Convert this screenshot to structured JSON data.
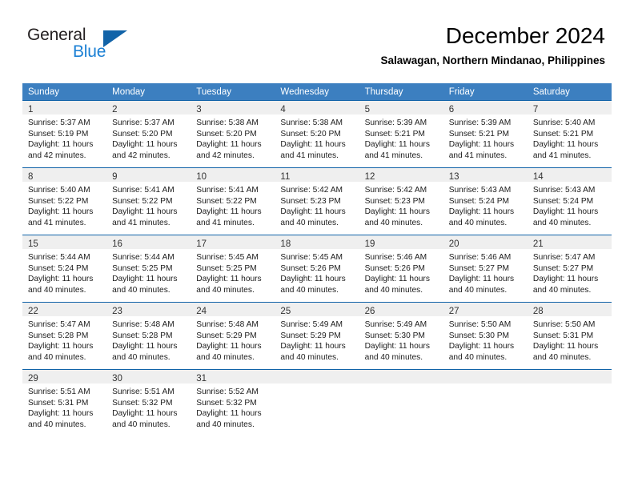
{
  "brand": {
    "name_part1": "General",
    "name_part2": "Blue",
    "accent_color": "#1163a8",
    "logo_blue_text_color": "#1a7fd4"
  },
  "header": {
    "title": "December 2024",
    "subtitle": "Salawagan, Northern Mindanao, Philippines"
  },
  "calendar": {
    "header_bg": "#3c7fc0",
    "row_line_color": "#1163a8",
    "daynum_band_bg": "#efefef",
    "weekday_headers": [
      "Sunday",
      "Monday",
      "Tuesday",
      "Wednesday",
      "Thursday",
      "Friday",
      "Saturday"
    ],
    "weeks": [
      [
        {
          "day": "1",
          "sunrise": "Sunrise: 5:37 AM",
          "sunset": "Sunset: 5:19 PM",
          "daylight": "Daylight: 11 hours and 42 minutes."
        },
        {
          "day": "2",
          "sunrise": "Sunrise: 5:37 AM",
          "sunset": "Sunset: 5:20 PM",
          "daylight": "Daylight: 11 hours and 42 minutes."
        },
        {
          "day": "3",
          "sunrise": "Sunrise: 5:38 AM",
          "sunset": "Sunset: 5:20 PM",
          "daylight": "Daylight: 11 hours and 42 minutes."
        },
        {
          "day": "4",
          "sunrise": "Sunrise: 5:38 AM",
          "sunset": "Sunset: 5:20 PM",
          "daylight": "Daylight: 11 hours and 41 minutes."
        },
        {
          "day": "5",
          "sunrise": "Sunrise: 5:39 AM",
          "sunset": "Sunset: 5:21 PM",
          "daylight": "Daylight: 11 hours and 41 minutes."
        },
        {
          "day": "6",
          "sunrise": "Sunrise: 5:39 AM",
          "sunset": "Sunset: 5:21 PM",
          "daylight": "Daylight: 11 hours and 41 minutes."
        },
        {
          "day": "7",
          "sunrise": "Sunrise: 5:40 AM",
          "sunset": "Sunset: 5:21 PM",
          "daylight": "Daylight: 11 hours and 41 minutes."
        }
      ],
      [
        {
          "day": "8",
          "sunrise": "Sunrise: 5:40 AM",
          "sunset": "Sunset: 5:22 PM",
          "daylight": "Daylight: 11 hours and 41 minutes."
        },
        {
          "day": "9",
          "sunrise": "Sunrise: 5:41 AM",
          "sunset": "Sunset: 5:22 PM",
          "daylight": "Daylight: 11 hours and 41 minutes."
        },
        {
          "day": "10",
          "sunrise": "Sunrise: 5:41 AM",
          "sunset": "Sunset: 5:22 PM",
          "daylight": "Daylight: 11 hours and 41 minutes."
        },
        {
          "day": "11",
          "sunrise": "Sunrise: 5:42 AM",
          "sunset": "Sunset: 5:23 PM",
          "daylight": "Daylight: 11 hours and 40 minutes."
        },
        {
          "day": "12",
          "sunrise": "Sunrise: 5:42 AM",
          "sunset": "Sunset: 5:23 PM",
          "daylight": "Daylight: 11 hours and 40 minutes."
        },
        {
          "day": "13",
          "sunrise": "Sunrise: 5:43 AM",
          "sunset": "Sunset: 5:24 PM",
          "daylight": "Daylight: 11 hours and 40 minutes."
        },
        {
          "day": "14",
          "sunrise": "Sunrise: 5:43 AM",
          "sunset": "Sunset: 5:24 PM",
          "daylight": "Daylight: 11 hours and 40 minutes."
        }
      ],
      [
        {
          "day": "15",
          "sunrise": "Sunrise: 5:44 AM",
          "sunset": "Sunset: 5:24 PM",
          "daylight": "Daylight: 11 hours and 40 minutes."
        },
        {
          "day": "16",
          "sunrise": "Sunrise: 5:44 AM",
          "sunset": "Sunset: 5:25 PM",
          "daylight": "Daylight: 11 hours and 40 minutes."
        },
        {
          "day": "17",
          "sunrise": "Sunrise: 5:45 AM",
          "sunset": "Sunset: 5:25 PM",
          "daylight": "Daylight: 11 hours and 40 minutes."
        },
        {
          "day": "18",
          "sunrise": "Sunrise: 5:45 AM",
          "sunset": "Sunset: 5:26 PM",
          "daylight": "Daylight: 11 hours and 40 minutes."
        },
        {
          "day": "19",
          "sunrise": "Sunrise: 5:46 AM",
          "sunset": "Sunset: 5:26 PM",
          "daylight": "Daylight: 11 hours and 40 minutes."
        },
        {
          "day": "20",
          "sunrise": "Sunrise: 5:46 AM",
          "sunset": "Sunset: 5:27 PM",
          "daylight": "Daylight: 11 hours and 40 minutes."
        },
        {
          "day": "21",
          "sunrise": "Sunrise: 5:47 AM",
          "sunset": "Sunset: 5:27 PM",
          "daylight": "Daylight: 11 hours and 40 minutes."
        }
      ],
      [
        {
          "day": "22",
          "sunrise": "Sunrise: 5:47 AM",
          "sunset": "Sunset: 5:28 PM",
          "daylight": "Daylight: 11 hours and 40 minutes."
        },
        {
          "day": "23",
          "sunrise": "Sunrise: 5:48 AM",
          "sunset": "Sunset: 5:28 PM",
          "daylight": "Daylight: 11 hours and 40 minutes."
        },
        {
          "day": "24",
          "sunrise": "Sunrise: 5:48 AM",
          "sunset": "Sunset: 5:29 PM",
          "daylight": "Daylight: 11 hours and 40 minutes."
        },
        {
          "day": "25",
          "sunrise": "Sunrise: 5:49 AM",
          "sunset": "Sunset: 5:29 PM",
          "daylight": "Daylight: 11 hours and 40 minutes."
        },
        {
          "day": "26",
          "sunrise": "Sunrise: 5:49 AM",
          "sunset": "Sunset: 5:30 PM",
          "daylight": "Daylight: 11 hours and 40 minutes."
        },
        {
          "day": "27",
          "sunrise": "Sunrise: 5:50 AM",
          "sunset": "Sunset: 5:30 PM",
          "daylight": "Daylight: 11 hours and 40 minutes."
        },
        {
          "day": "28",
          "sunrise": "Sunrise: 5:50 AM",
          "sunset": "Sunset: 5:31 PM",
          "daylight": "Daylight: 11 hours and 40 minutes."
        }
      ],
      [
        {
          "day": "29",
          "sunrise": "Sunrise: 5:51 AM",
          "sunset": "Sunset: 5:31 PM",
          "daylight": "Daylight: 11 hours and 40 minutes."
        },
        {
          "day": "30",
          "sunrise": "Sunrise: 5:51 AM",
          "sunset": "Sunset: 5:32 PM",
          "daylight": "Daylight: 11 hours and 40 minutes."
        },
        {
          "day": "31",
          "sunrise": "Sunrise: 5:52 AM",
          "sunset": "Sunset: 5:32 PM",
          "daylight": "Daylight: 11 hours and 40 minutes."
        },
        {
          "day": "",
          "sunrise": "",
          "sunset": "",
          "daylight": ""
        },
        {
          "day": "",
          "sunrise": "",
          "sunset": "",
          "daylight": ""
        },
        {
          "day": "",
          "sunrise": "",
          "sunset": "",
          "daylight": ""
        },
        {
          "day": "",
          "sunrise": "",
          "sunset": "",
          "daylight": ""
        }
      ]
    ]
  }
}
